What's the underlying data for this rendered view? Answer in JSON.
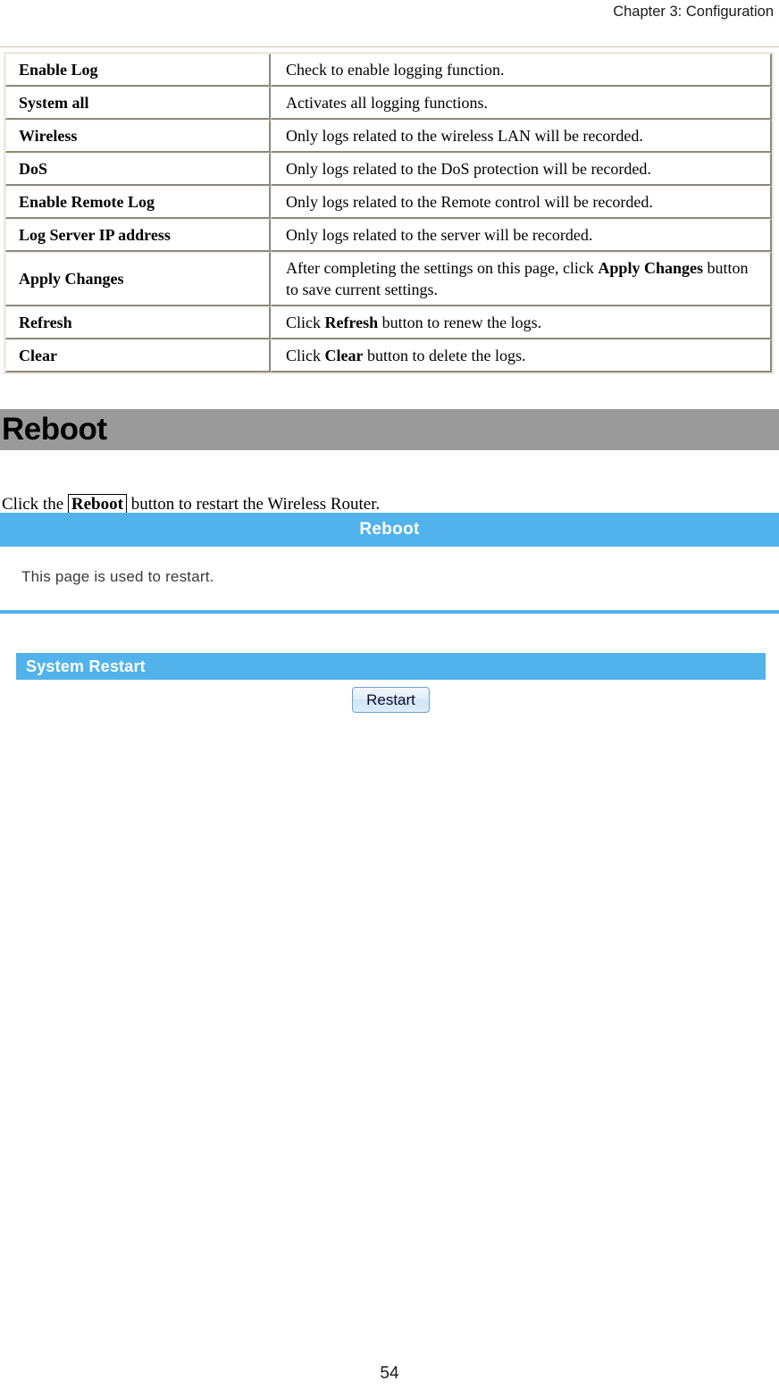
{
  "header": {
    "chapter": "Chapter 3: Configuration"
  },
  "log_table": {
    "rows": [
      {
        "term": "Enable Log",
        "definition_html": "Check to enable logging function."
      },
      {
        "term": "System all",
        "definition_html": "Activates all logging functions."
      },
      {
        "term": "Wireless",
        "definition_html": "Only logs related to the wireless LAN will be recorded."
      },
      {
        "term": "DoS",
        "definition_html": "Only logs related to the DoS protection will be recorded."
      },
      {
        "term": "Enable Remote Log",
        "definition_html": "Only logs related to the Remote control will be recorded."
      },
      {
        "term": "Log Server IP address",
        "definition_html": "Only logs related to the server will be recorded."
      },
      {
        "term": "Apply Changes",
        "definition_html": "After completing the settings on this page, click <b>Apply Changes</b> button to save current settings."
      },
      {
        "term": "Refresh",
        "definition_html": "Click <b>Refresh</b> button to renew the logs."
      },
      {
        "term": "Clear",
        "definition_html": "Click <b>Clear</b> button to delete the logs."
      }
    ]
  },
  "section": {
    "title": "Reboot"
  },
  "intro": {
    "before": "Click the ",
    "boxed": "Reboot",
    "after": " button to restart the Wireless Router."
  },
  "router_ui": {
    "title": "Reboot",
    "description": "This page is used to restart.",
    "subsection_title": "System Restart",
    "restart_button_label": "Restart",
    "accent_color": "#52b3ec"
  },
  "footer": {
    "page_number": "54"
  }
}
